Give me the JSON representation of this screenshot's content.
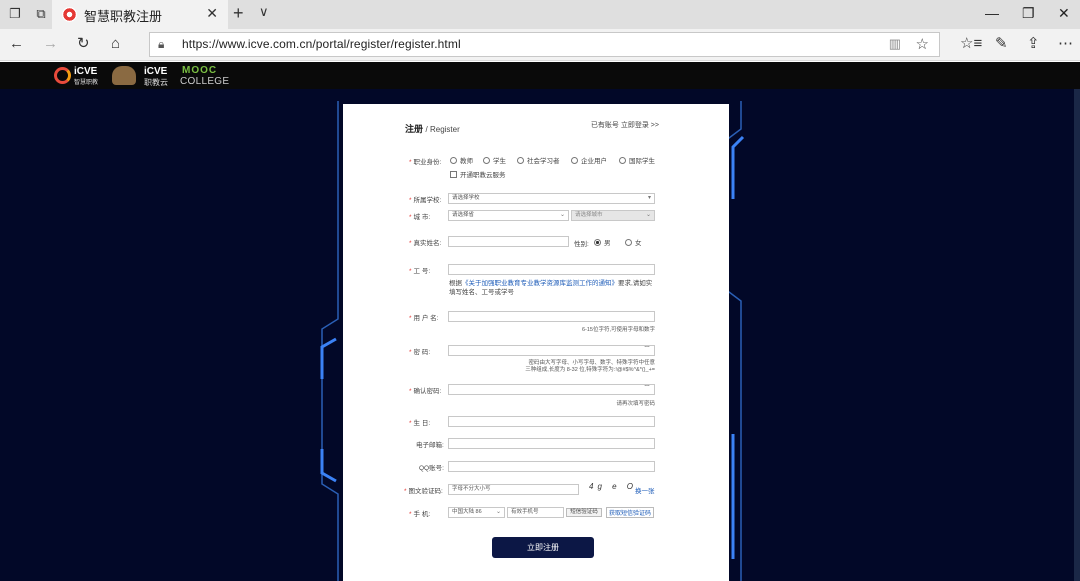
{
  "browser": {
    "tab_title": "智慧职教注册",
    "url": "https://www.icve.com.cn/portal/register/register.html"
  },
  "site": {
    "logo1": {
      "name": "iCVE",
      "sub": "智慧职教"
    },
    "logo2": {
      "name": "iCVE",
      "sub": "职教云"
    },
    "logo3": {
      "name": "MOOC",
      "sub": "COLLEGE"
    }
  },
  "form": {
    "title": "注册",
    "subtitle": "/ Register",
    "have_account": "已有账号 立即登录 >>",
    "identity": {
      "label": "职业身份:",
      "options": [
        "教师",
        "学生",
        "社会学习者",
        "企业用户",
        "国际学生"
      ],
      "open_cloud": "开通职教云服务"
    },
    "school": {
      "label": "所属学校:",
      "value": "请选择学校"
    },
    "city": {
      "label": "城        市:",
      "province": "请选择省",
      "city": "请选择城市"
    },
    "realname": {
      "label": "真实姓名:",
      "gender_label": "性别:",
      "male": "男",
      "female": "女"
    },
    "work_id": {
      "label": "工        号:",
      "notice_prefix": "根据",
      "notice_link": "《关于加强职业教育专业教学资源库监测工作的通知》",
      "notice_suffix": "要求,请如实填写姓名、工号或学号"
    },
    "username": {
      "label": "用  户  名:",
      "hint": "6-15位字符,可使用字母和数字"
    },
    "password": {
      "label": "密        码:",
      "hint1": "密码由大写字母、小写字母、数字、特殊字符中任意",
      "hint2": "三种组成,长度为 8-32 位,特殊字符为:!@#$%^&*()_+="
    },
    "confirm": {
      "label": "确认密码:",
      "hint": "请再次填写密码"
    },
    "birthday": {
      "label": "生        日:"
    },
    "email": {
      "label": "电子邮箱:"
    },
    "qq": {
      "label": "QQ账号:"
    },
    "captcha": {
      "label": "图文验证码:",
      "placeholder": "字母不分大小写",
      "code": "4g e O",
      "refresh": "换一张"
    },
    "phone": {
      "label": "手        机:",
      "country": "中国大陆 86",
      "placeholder": "有效手机号",
      "sms_btn": "短信验证码",
      "get_code": "获取短信验证码"
    },
    "submit": "立即注册"
  }
}
